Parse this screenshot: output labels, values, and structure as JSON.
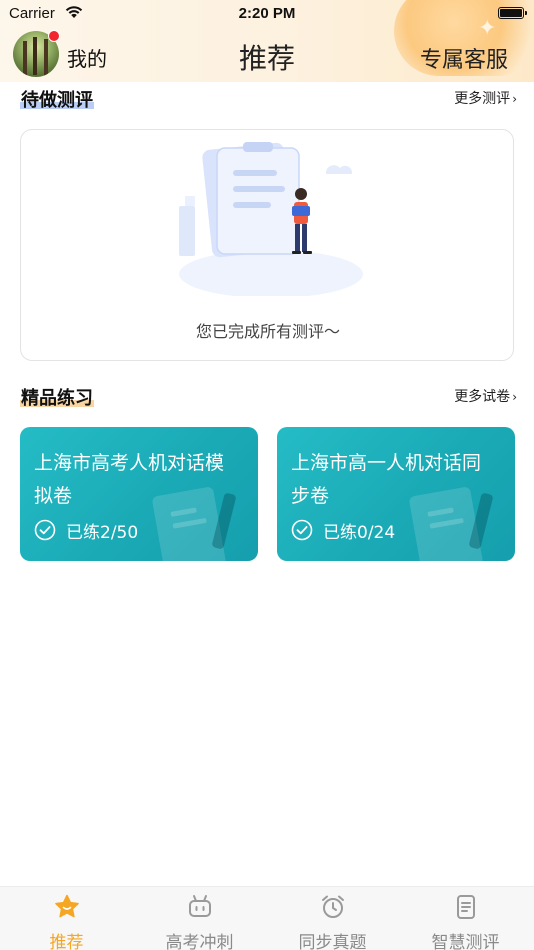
{
  "status_bar": {
    "carrier": "Carrier",
    "time": "2:20 PM"
  },
  "header": {
    "my_label": "我的",
    "title": "推荐",
    "service_label": "专属客服"
  },
  "pending_section": {
    "title": "待做测评",
    "more_label": "更多测评",
    "empty_text": "您已完成所有测评～"
  },
  "practice_section": {
    "title": "精品练习",
    "more_label": "更多试卷",
    "cards": [
      {
        "title": "上海市高考人机对话模拟卷",
        "progress": "已练2/50"
      },
      {
        "title": "上海市高一人机对话同步卷",
        "progress": "已练0/24"
      }
    ]
  },
  "tabbar": {
    "tabs": [
      {
        "label": "推荐",
        "icon": "star-icon",
        "active": true
      },
      {
        "label": "高考冲刺",
        "icon": "robot-icon",
        "active": false
      },
      {
        "label": "同步真题",
        "icon": "alarm-clock-icon",
        "active": false
      },
      {
        "label": "智慧测评",
        "icon": "document-icon",
        "active": false
      }
    ]
  },
  "colors": {
    "accent": "#f5a623",
    "card_teal": "#1aaab6",
    "tab_inactive": "#8a8a8a",
    "badge_red": "#f2262f"
  }
}
